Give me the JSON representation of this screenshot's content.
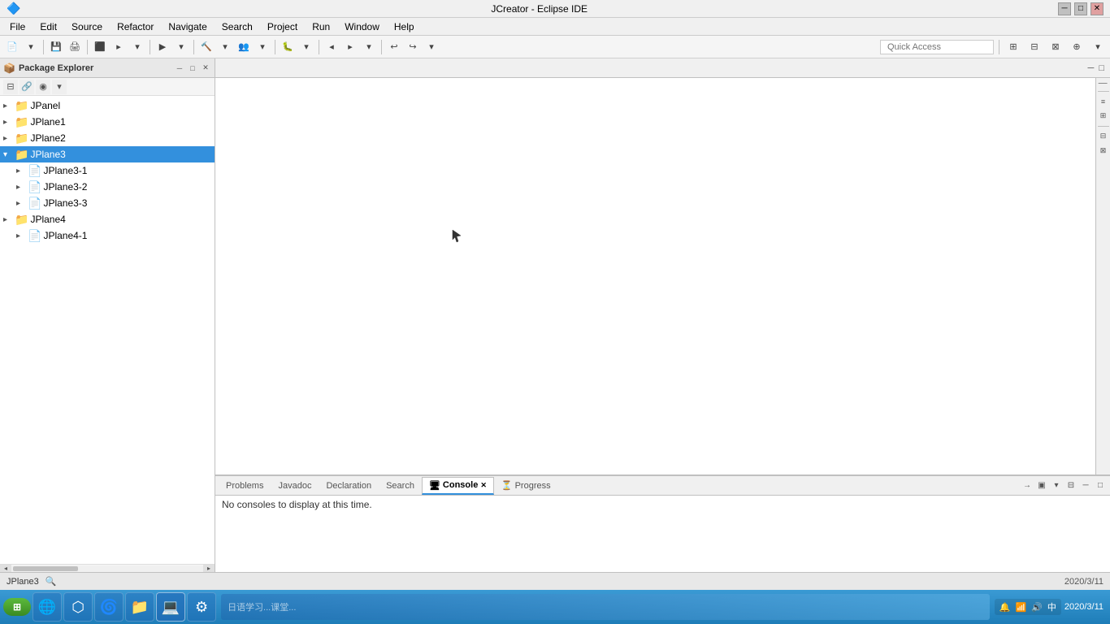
{
  "window": {
    "title": "JCreator - Eclipse IDE",
    "controls": {
      "minimize": "─",
      "maximize": "□",
      "close": "✕"
    }
  },
  "menubar": {
    "items": [
      "File",
      "Edit",
      "Source",
      "Refactor",
      "Navigate",
      "Search",
      "Project",
      "Run",
      "Window",
      "Help"
    ]
  },
  "toolbar": {
    "quick_access_label": "Quick Access",
    "quick_access_placeholder": "Quick Access"
  },
  "package_explorer": {
    "title": "Package Explorer",
    "close_icon": "✕",
    "minimize_icon": "─",
    "maximize_icon": "□",
    "toolbar_icons": [
      "⊞",
      "⊟",
      "◉",
      "▼"
    ],
    "tree_items": [
      {
        "id": "JPanel",
        "label": "JPanel",
        "level": 0,
        "selected": false,
        "expanded": false
      },
      {
        "id": "JPlane1",
        "label": "JPlane1",
        "level": 0,
        "selected": false,
        "expanded": false
      },
      {
        "id": "JPlane2",
        "label": "JPlane2",
        "level": 0,
        "selected": false,
        "expanded": false
      },
      {
        "id": "JPlane3",
        "label": "JPlane3",
        "level": 0,
        "selected": true,
        "expanded": true
      },
      {
        "id": "JPlane3-1",
        "label": "JPlane3-1",
        "level": 1,
        "selected": false,
        "expanded": false
      },
      {
        "id": "JPlane3-2",
        "label": "JPlane3-2",
        "level": 1,
        "selected": false,
        "expanded": false
      },
      {
        "id": "JPlane3-3",
        "label": "JPlane3-3",
        "level": 1,
        "selected": false,
        "expanded": false
      },
      {
        "id": "JPlane4",
        "label": "JPlane4",
        "level": 0,
        "selected": false,
        "expanded": false
      },
      {
        "id": "JPlane4-1",
        "label": "JPlane4-1",
        "level": 1,
        "selected": false,
        "expanded": false
      }
    ]
  },
  "editor": {
    "tabs": [],
    "controls": {
      "minimize": "─",
      "maximize": "□"
    }
  },
  "bottom_panel": {
    "tabs": [
      {
        "id": "problems",
        "label": "Problems",
        "active": false
      },
      {
        "id": "javadoc",
        "label": "Javadoc",
        "active": false
      },
      {
        "id": "declaration",
        "label": "Declaration",
        "active": false
      },
      {
        "id": "search",
        "label": "Search",
        "active": false
      },
      {
        "id": "console",
        "label": "Console",
        "active": true
      },
      {
        "id": "progress",
        "label": "Progress",
        "active": false
      }
    ],
    "console_message": "No consoles to display at this time.",
    "controls": {
      "arrow": "→",
      "monitor": "▣",
      "expand": "⊟",
      "minimize": "─",
      "maximize": "□"
    }
  },
  "status_bar": {
    "current_item": "JPlane3",
    "date": "2020/3/11"
  },
  "taskbar": {
    "start_label": "⊞",
    "apps": [
      "🌐",
      "🔵",
      "🌀",
      "📁",
      "💻",
      "⚙"
    ],
    "tray_icons": [
      "🔔",
      "📶",
      "🔊",
      "🇨🇳"
    ],
    "time": "2020/3/11"
  }
}
